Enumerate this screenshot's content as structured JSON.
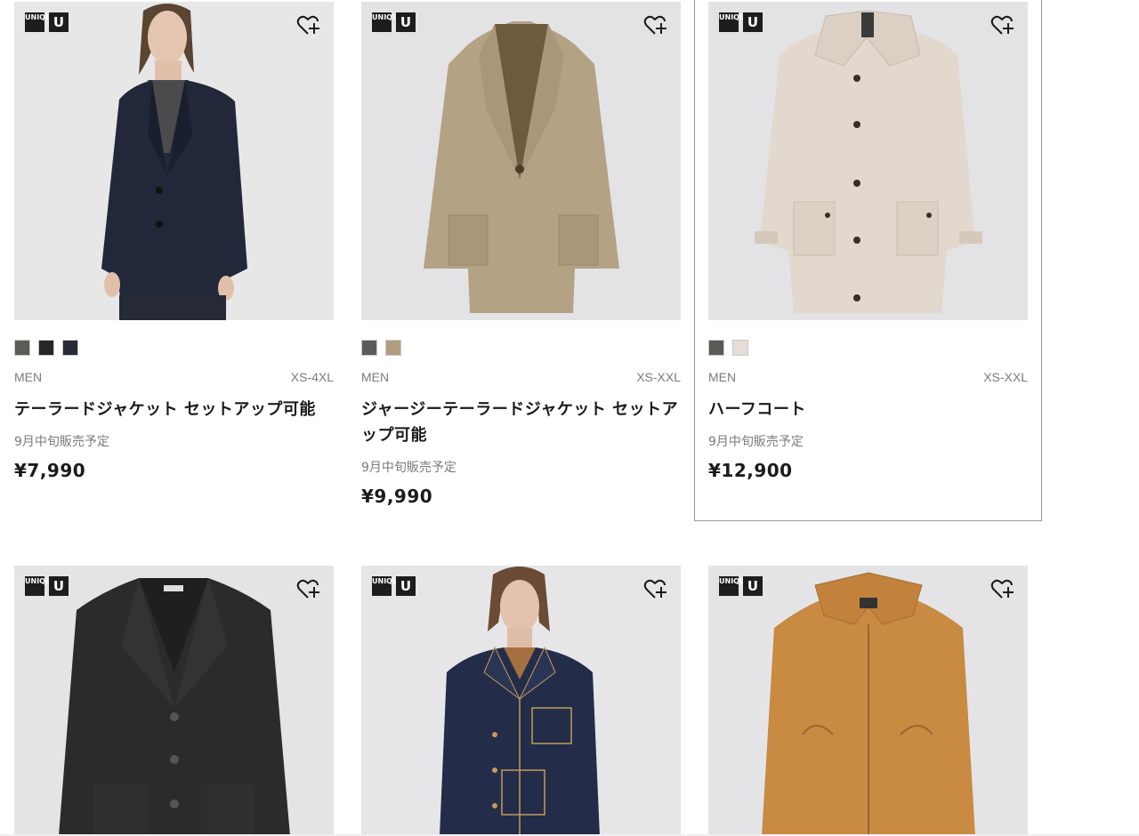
{
  "brand": {
    "logo_uniqlo": [
      "UNI",
      "QLO"
    ],
    "logo_u": "U"
  },
  "products": [
    {
      "gender": "MEN",
      "sizes": "XS-4XL",
      "name": "テーラードジャケット セットアップ可能",
      "release": "9月中旬販売予定",
      "price": "¥7,990",
      "swatches": [
        "#5d5b55",
        "#262626",
        "#272b37"
      ],
      "image": "navy-tailored-jacket-on-model"
    },
    {
      "gender": "MEN",
      "sizes": "XS-XXL",
      "name": "ジャージーテーラードジャケット セットアップ可能",
      "release": "9月中旬販売予定",
      "price": "¥9,990",
      "swatches": [
        "#5b5b5b",
        "#b19e7f"
      ],
      "image": "beige-jersey-tailored-jacket"
    },
    {
      "gender": "MEN",
      "sizes": "XS-XXL",
      "name": "ハーフコート",
      "release": "9月中旬販売予定",
      "price": "¥12,900",
      "swatches": [
        "#5b5a56",
        "#e6ddd6"
      ],
      "image": "light-beige-half-coat"
    },
    {
      "image": "black-knit-jacket"
    },
    {
      "image": "denim-jacket-on-model"
    },
    {
      "image": "orange-corduroy-blouson"
    }
  ]
}
